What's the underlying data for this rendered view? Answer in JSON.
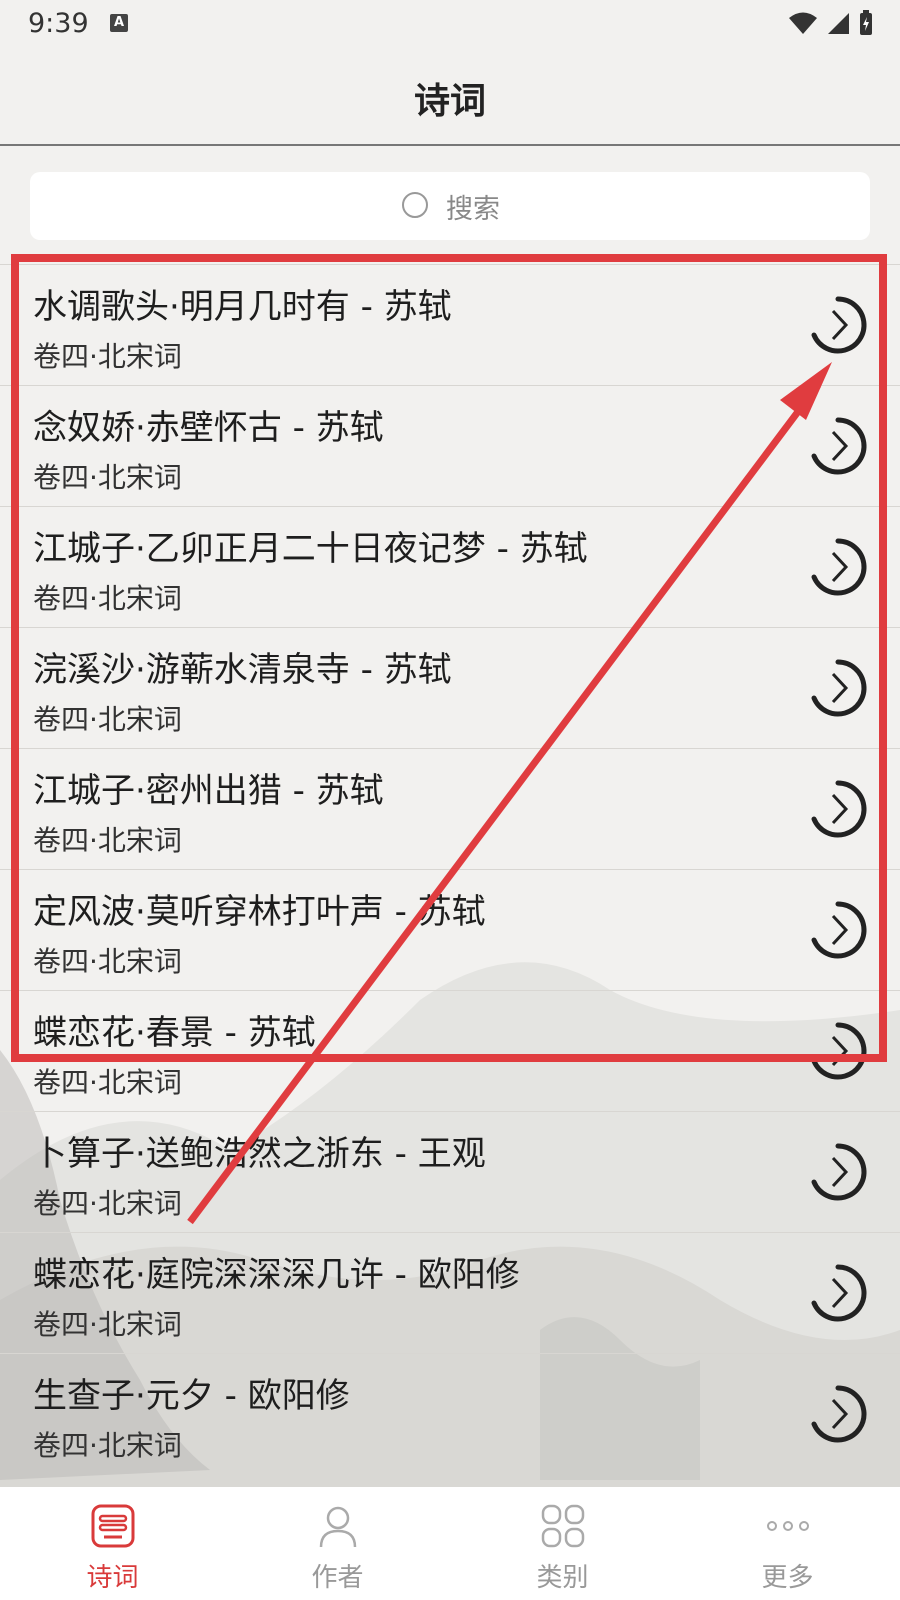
{
  "status": {
    "time": "9:39",
    "keyboard_badge": "A"
  },
  "header": {
    "title": "诗词"
  },
  "search": {
    "placeholder": "搜索"
  },
  "poems": [
    {
      "title": "水调歌头·明月几时有 - 苏轼",
      "subtitle": "卷四·北宋词"
    },
    {
      "title": "念奴娇·赤壁怀古 - 苏轼",
      "subtitle": "卷四·北宋词"
    },
    {
      "title": "江城子·乙卯正月二十日夜记梦 - 苏轼",
      "subtitle": "卷四·北宋词"
    },
    {
      "title": "浣溪沙·游蕲水清泉寺 - 苏轼",
      "subtitle": "卷四·北宋词"
    },
    {
      "title": "江城子·密州出猎 - 苏轼",
      "subtitle": "卷四·北宋词"
    },
    {
      "title": "定风波·莫听穿林打叶声 - 苏轼",
      "subtitle": "卷四·北宋词"
    },
    {
      "title": "蝶恋花·春景 - 苏轼",
      "subtitle": "卷四·北宋词"
    },
    {
      "title": "卜算子·送鲍浩然之浙东 - 王观",
      "subtitle": "卷四·北宋词"
    },
    {
      "title": "蝶恋花·庭院深深深几许 - 欧阳修",
      "subtitle": "卷四·北宋词"
    },
    {
      "title": "生查子·元夕 - 欧阳修",
      "subtitle": "卷四·北宋词"
    }
  ],
  "tabs": [
    {
      "label": "诗词",
      "icon": "poem-scroll-icon",
      "active": true
    },
    {
      "label": "作者",
      "icon": "person-icon",
      "active": false
    },
    {
      "label": "类别",
      "icon": "grid-icon",
      "active": false
    },
    {
      "label": "更多",
      "icon": "more-dots-icon",
      "active": false
    }
  ],
  "colors": {
    "accent": "#d93a3a",
    "annotation": "#e03c3f"
  }
}
